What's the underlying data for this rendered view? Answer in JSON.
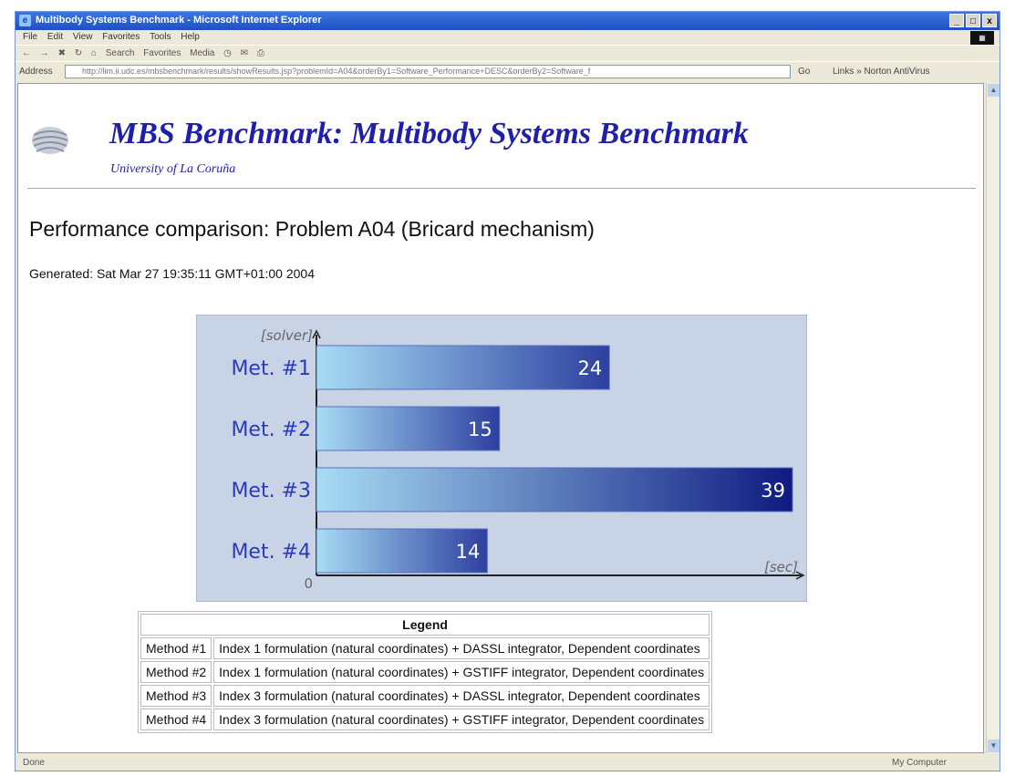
{
  "window": {
    "title": "Multibody Systems Benchmark - Microsoft Internet Explorer",
    "controls": [
      "_",
      "□",
      "x"
    ]
  },
  "menu": [
    "File",
    "Edit",
    "View",
    "Favorites",
    "Tools",
    "Help"
  ],
  "toolbar": {
    "search": "Search",
    "favorites": "Favorites",
    "media": "Media"
  },
  "address": {
    "label": "Address",
    "url": "http://lim.ii.udc.es/mbsbenchmark/results/showResults.jsp?problemId=A04&orderBy1=Software_Performance+DESC&orderBy2=Software_f",
    "go": "Go",
    "links": "Links » Norton AntiVirus"
  },
  "page": {
    "site_title": "MBS Benchmark: Multibody Systems Benchmark",
    "site_subtitle": "University of La Coruña",
    "heading": "Performance comparison: Problem A04 (Bricard mechanism)",
    "generated": "Generated: Sat Mar 27 19:35:11 GMT+01:00 2004"
  },
  "chart_data": {
    "type": "bar",
    "orientation": "horizontal",
    "categories": [
      "Met. #1",
      "Met. #2",
      "Met. #3",
      "Met. #4"
    ],
    "values": [
      24,
      15,
      39,
      14
    ],
    "ylabel": "[solver]",
    "xlabel": "[sec]",
    "origin_label": "0",
    "xlim": [
      0,
      39
    ],
    "colors": {
      "panel": "#c9d3e6",
      "bar_light": "#a8dcf4",
      "bar_dark": "#2d3fa0",
      "bar_darkest": "#0f1a80",
      "label": "#2b3bb8"
    }
  },
  "legend": {
    "header": "Legend",
    "rows": [
      {
        "method": "Method #1",
        "description": "Index 1 formulation (natural coordinates) + DASSL integrator, Dependent coordinates"
      },
      {
        "method": "Method #2",
        "description": "Index 1 formulation (natural coordinates) + GSTIFF integrator, Dependent coordinates"
      },
      {
        "method": "Method #3",
        "description": "Index 3 formulation (natural coordinates) + DASSL integrator, Dependent coordinates"
      },
      {
        "method": "Method #4",
        "description": "Index 3 formulation (natural coordinates) + GSTIFF integrator, Dependent coordinates"
      }
    ]
  },
  "status": {
    "text": "Done",
    "zone": "My Computer"
  }
}
